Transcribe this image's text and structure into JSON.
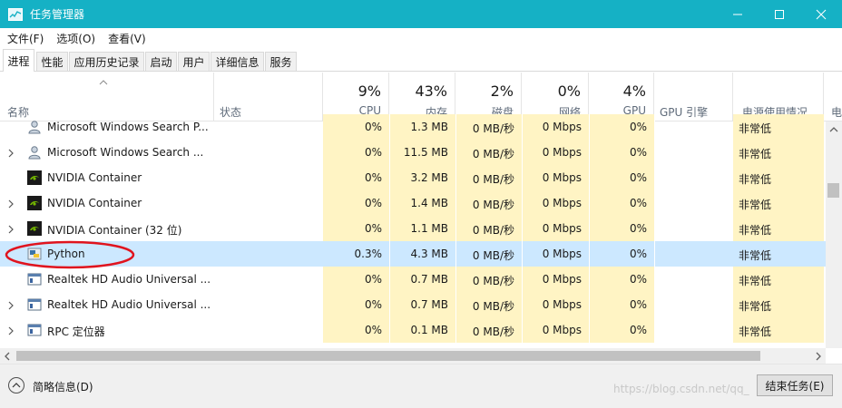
{
  "window": {
    "title": "任务管理器"
  },
  "menu": [
    "文件(F)",
    "选项(O)",
    "查看(V)"
  ],
  "tabs": [
    "进程",
    "性能",
    "应用历史记录",
    "启动",
    "用户",
    "详细信息",
    "服务"
  ],
  "header": {
    "name": "名称",
    "status": "状态",
    "cpu_pct": "9%",
    "cpu": "CPU",
    "mem_pct": "43%",
    "mem": "内存",
    "disk_pct": "2%",
    "disk": "磁盘",
    "net_pct": "0%",
    "net": "网络",
    "gpu_pct": "4%",
    "gpu": "GPU",
    "gpu_engine": "GPU 引擎",
    "power": "电源使用情况",
    "power_trend": "电"
  },
  "rows": [
    {
      "name": "Microsoft Windows Search P...",
      "icon": "search-person-icon",
      "expand": false,
      "cpu": "0%",
      "mem": "1.3 MB",
      "disk": "0 MB/秒",
      "net": "0 Mbps",
      "gpu": "0%",
      "power": "非常低"
    },
    {
      "name": "Microsoft Windows Search ...",
      "icon": "search-person-icon",
      "expand": true,
      "cpu": "0%",
      "mem": "11.5 MB",
      "disk": "0 MB/秒",
      "net": "0 Mbps",
      "gpu": "0%",
      "power": "非常低"
    },
    {
      "name": "NVIDIA Container",
      "icon": "nvidia-icon",
      "expand": false,
      "cpu": "0%",
      "mem": "3.2 MB",
      "disk": "0 MB/秒",
      "net": "0 Mbps",
      "gpu": "0%",
      "power": "非常低"
    },
    {
      "name": "NVIDIA Container",
      "icon": "nvidia-icon",
      "expand": true,
      "cpu": "0%",
      "mem": "1.4 MB",
      "disk": "0 MB/秒",
      "net": "0 Mbps",
      "gpu": "0%",
      "power": "非常低"
    },
    {
      "name": "NVIDIA Container (32 位)",
      "icon": "nvidia-icon",
      "expand": true,
      "cpu": "0%",
      "mem": "1.1 MB",
      "disk": "0 MB/秒",
      "net": "0 Mbps",
      "gpu": "0%",
      "power": "非常低"
    },
    {
      "name": "Python",
      "icon": "python-icon",
      "expand": false,
      "selected": true,
      "cpu": "0.3%",
      "mem": "4.3 MB",
      "disk": "0 MB/秒",
      "net": "0 Mbps",
      "gpu": "0%",
      "power": "非常低"
    },
    {
      "name": "Realtek HD Audio Universal ...",
      "icon": "app-window-icon",
      "expand": false,
      "cpu": "0%",
      "mem": "0.7 MB",
      "disk": "0 MB/秒",
      "net": "0 Mbps",
      "gpu": "0%",
      "power": "非常低"
    },
    {
      "name": "Realtek HD Audio Universal ...",
      "icon": "app-window-icon",
      "expand": true,
      "cpu": "0%",
      "mem": "0.7 MB",
      "disk": "0 MB/秒",
      "net": "0 Mbps",
      "gpu": "0%",
      "power": "非常低"
    },
    {
      "name": "RPC 定位器",
      "icon": "app-window-icon",
      "expand": true,
      "cpu": "0%",
      "mem": "0.1 MB",
      "disk": "0 MB/秒",
      "net": "0 Mbps",
      "gpu": "0%",
      "power": "非常低"
    }
  ],
  "footer": {
    "summary": "简略信息(D)",
    "end_task": "结束任务(E)",
    "watermark": "https://blog.csdn.net/qq_"
  },
  "colors": {
    "titlebar": "#15b1c5",
    "heat": "#fff4c4",
    "selection": "#cce8ff",
    "annotation": "#e0141e"
  }
}
